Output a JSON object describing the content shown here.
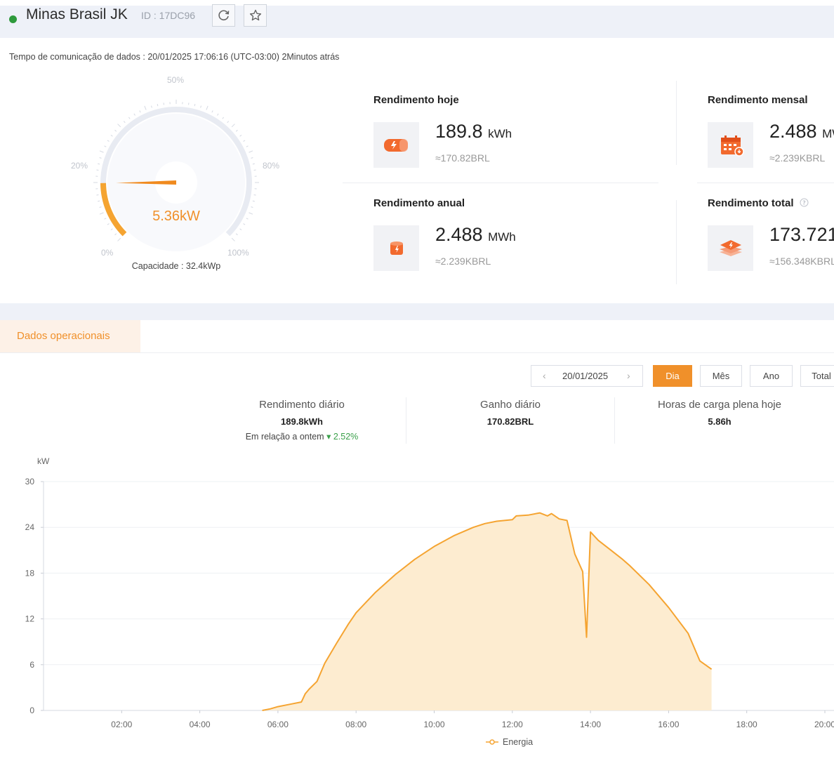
{
  "header": {
    "plant_name": "Minas Brasil JK",
    "id_text": "ID : 17DC96",
    "status_color": "#2e9a3c",
    "refresh_icon": "refresh-icon",
    "favorite_icon": "star-icon"
  },
  "comm_time": "Tempo de comunicação de dados :  20/01/2025 17:06:16 (UTC-03:00) 2Minutos atrás",
  "gauge": {
    "value_text": "5.36kW",
    "capacity_text": "Capacidade :  32.4kWp",
    "fraction": 0.165,
    "labels": {
      "p0": "0%",
      "p20": "20%",
      "p50": "50%",
      "p80": "80%",
      "p100": "100%"
    }
  },
  "stats": {
    "today": {
      "title": "Rendimento hoje",
      "value": "189.8",
      "unit": "kWh",
      "sub": "≈170.82BRL",
      "icon": "battery-icon"
    },
    "monthly": {
      "title": "Rendimento mensal",
      "value": "2.488",
      "unit": "MWh",
      "sub": "≈2.239KBRL",
      "icon": "calendar-icon"
    },
    "annual": {
      "title": "Rendimento anual",
      "value": "2.488",
      "unit": "MWh",
      "sub": "≈2.239KBRL",
      "icon": "cylinder-icon"
    },
    "total": {
      "title": "Rendimento total",
      "value": "173.721",
      "unit": "",
      "sub": "≈156.348KBRL",
      "icon": "layers-icon"
    }
  },
  "tabs": {
    "active": "Dados operacionais"
  },
  "controls": {
    "date": "20/01/2025",
    "segments": [
      "Dia",
      "Mês",
      "Ano",
      "Total"
    ],
    "active_segment": "Dia"
  },
  "kpis": {
    "daily_yield": {
      "title": "Rendimento diário",
      "value": "189.8kWh",
      "compare_label": "Em relação a ontem",
      "compare_pct": "2.52%"
    },
    "daily_gain": {
      "title": "Ganho diário",
      "value": "170.82BRL"
    },
    "full_load": {
      "title": "Horas de carga plena hoje",
      "value": "5.86h"
    }
  },
  "chart_data": {
    "type": "area",
    "ylabel": "kW",
    "ylim": [
      0,
      30
    ],
    "yticks": [
      0,
      6,
      12,
      18,
      24,
      30
    ],
    "xlim": [
      0,
      20
    ],
    "xticks": [
      "02:00",
      "04:00",
      "06:00",
      "08:00",
      "10:00",
      "12:00",
      "14:00",
      "16:00",
      "18:00",
      "20:00"
    ],
    "grid": true,
    "legend": "bottom-center",
    "color": "#f5a431",
    "fill": "#fdecd0",
    "series": [
      {
        "name": "Energia",
        "x": [
          5.6,
          5.8,
          6.0,
          6.3,
          6.6,
          6.7,
          6.8,
          7.0,
          7.2,
          7.5,
          7.8,
          8.0,
          8.5,
          9.0,
          9.5,
          10.0,
          10.5,
          11.0,
          11.3,
          11.6,
          12.0,
          12.1,
          12.4,
          12.7,
          12.9,
          13.0,
          13.2,
          13.4,
          13.6,
          13.8,
          13.9,
          14.0,
          14.2,
          14.5,
          14.8,
          15.0,
          15.5,
          16.0,
          16.5,
          16.8,
          17.1
        ],
        "y": [
          0.0,
          0.2,
          0.5,
          0.8,
          1.1,
          2.2,
          2.8,
          3.8,
          6.2,
          8.8,
          11.3,
          12.8,
          15.5,
          17.8,
          19.8,
          21.5,
          22.9,
          24.0,
          24.5,
          24.8,
          25.0,
          25.5,
          25.6,
          25.9,
          25.5,
          25.8,
          25.1,
          24.9,
          20.5,
          18.2,
          9.6,
          23.4,
          22.3,
          21.1,
          19.9,
          19.0,
          16.5,
          13.5,
          10.1,
          6.5,
          5.4
        ]
      }
    ]
  }
}
